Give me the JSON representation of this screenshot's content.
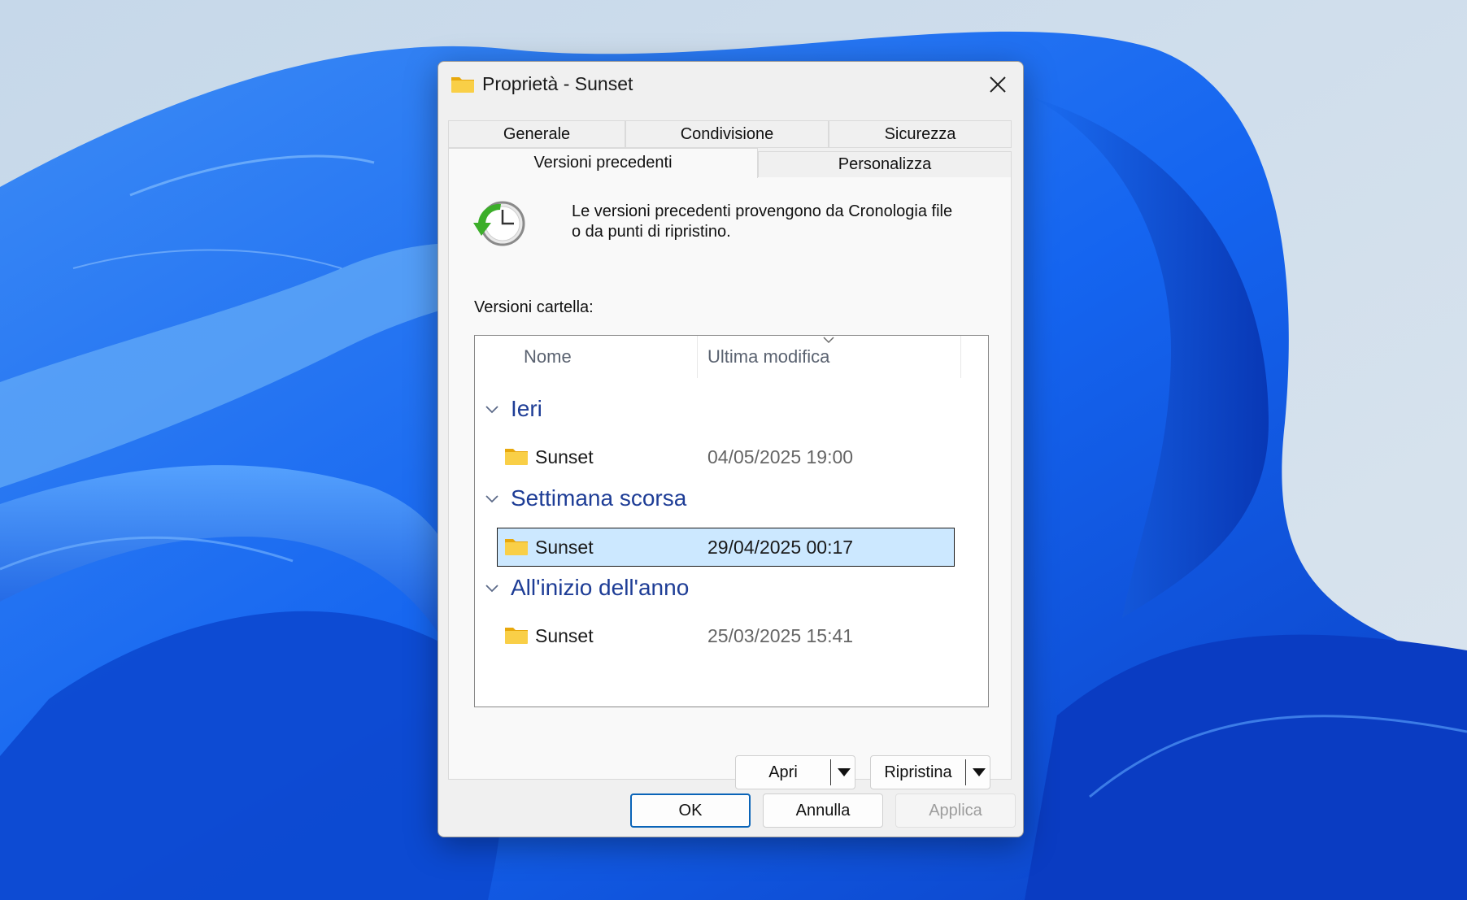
{
  "window": {
    "title": "Proprietà - Sunset",
    "icon": "folder-icon"
  },
  "tabs": {
    "row1": [
      "Generale",
      "Condivisione",
      "Sicurezza"
    ],
    "row2": [
      "Versioni precedenti",
      "Personalizza"
    ],
    "active": "Versioni precedenti"
  },
  "panel": {
    "icon": "history-clock-icon",
    "info_line1": "Le versioni precedenti provengono da Cronologia file",
    "info_line2": "o da punti di ripristino.",
    "versions_label": "Versioni cartella:"
  },
  "list": {
    "columns": [
      "Nome",
      "Ultima modifica"
    ],
    "sorted_by": "Ultima modifica",
    "groups": [
      {
        "label": "Ieri",
        "items": [
          {
            "name": "Sunset",
            "modified": "04/05/2025 19:00",
            "selected": false
          }
        ]
      },
      {
        "label": "Settimana scorsa",
        "items": [
          {
            "name": "Sunset",
            "modified": "29/04/2025 00:17",
            "selected": true
          }
        ]
      },
      {
        "label": "All'inizio dell'anno",
        "items": [
          {
            "name": "Sunset",
            "modified": "25/03/2025 15:41",
            "selected": false
          }
        ]
      }
    ]
  },
  "actions": {
    "open_label": "Apri",
    "restore_label": "Ripristina"
  },
  "buttons": {
    "ok": "OK",
    "cancel": "Annulla",
    "apply": "Applica",
    "apply_disabled": true
  },
  "colors": {
    "group_header": "#1e3d96",
    "selection": "#cce8ff",
    "default_button_border": "#0a64b8",
    "folder": "#f5c42c"
  }
}
